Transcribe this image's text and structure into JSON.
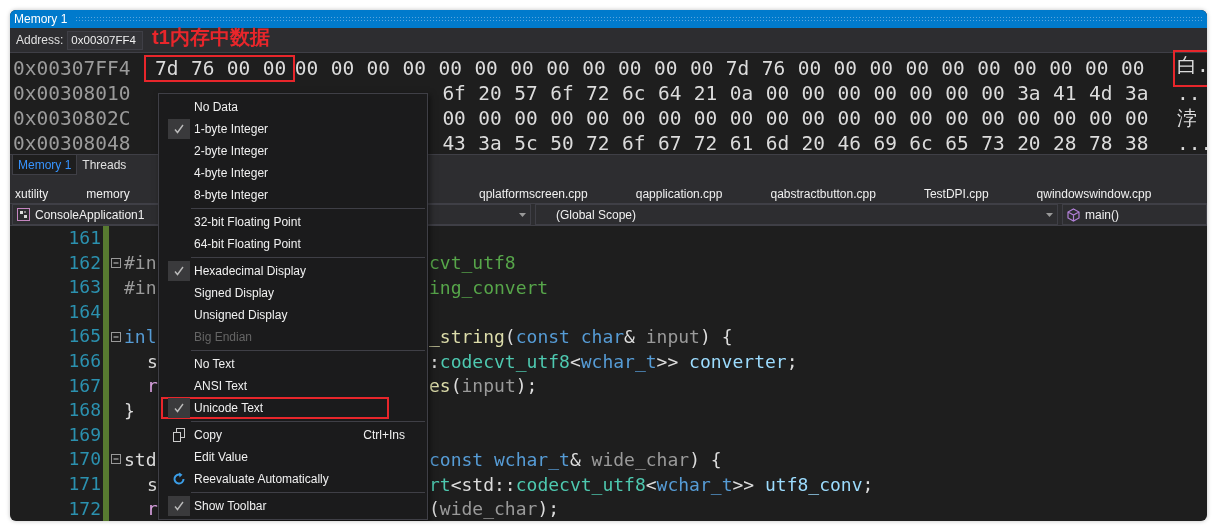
{
  "window": {
    "title": "Memory 1"
  },
  "annotation": {
    "label": "t1内存中数据"
  },
  "address_bar": {
    "label": "Address:",
    "value": "0x00307FF4"
  },
  "memory_rows": [
    {
      "address": "0x00307FF4",
      "marked_bytes": [
        "7d",
        "76",
        "00",
        "00"
      ],
      "bytes": [
        "00",
        "00",
        "00",
        "00",
        "00",
        "00",
        "00",
        "00",
        "00",
        "00",
        "00",
        "00",
        "7d",
        "76",
        "00",
        "00",
        "00",
        "00",
        "00",
        "00",
        "00",
        "00",
        "00",
        "00"
      ],
      "text": "白.",
      "text_marked": true
    },
    {
      "address": "0x00308010",
      "after_menu": [
        "6f",
        "20",
        "57",
        "6f",
        "72",
        "6c",
        "64",
        "21",
        "0a",
        "00",
        "00",
        "00",
        "00",
        "00",
        "00",
        "00",
        "3a",
        "41",
        "4d",
        "3a"
      ],
      "text": "..",
      "text_marked": false
    },
    {
      "address": "0x0030802C",
      "after_menu": [
        "00",
        "00",
        "00",
        "00",
        "00",
        "00",
        "00",
        "00",
        "00",
        "00",
        "00",
        "00",
        "00",
        "00",
        "00",
        "00",
        "00",
        "00",
        "00",
        "00"
      ],
      "text": "浡",
      "text_marked": false
    },
    {
      "address": "0x00308048",
      "after_menu": [
        "43",
        "3a",
        "5c",
        "50",
        "72",
        "6f",
        "67",
        "72",
        "61",
        "6d",
        "20",
        "46",
        "69",
        "6c",
        "65",
        "73",
        "20",
        "28",
        "78",
        "38"
      ],
      "text": "...",
      "text_marked": false
    }
  ],
  "panel_tabs": [
    {
      "label": "Memory 1",
      "selected": true
    },
    {
      "label": "Threads",
      "selected": false
    }
  ],
  "file_tabs_left": [
    "xutility",
    "memory"
  ],
  "file_tabs_right": [
    "qplatformscreen.cpp",
    "qapplication.cpp",
    "qabstractbutton.cpp",
    "TestDPI.cpp",
    "qwindowswindow.cpp"
  ],
  "nav_bar": {
    "project": "ConsoleApplication1",
    "scope": "(Global Scope)",
    "member": "main()"
  },
  "code_lines": [
    {
      "number": "161",
      "fold": false
    },
    {
      "number": "162",
      "fold": true,
      "indent": false,
      "left": [
        {
          "t": "#in",
          "kind": "preproc"
        }
      ],
      "right": [
        {
          "t": "cvt_utf8",
          "kind": "green"
        }
      ]
    },
    {
      "number": "163",
      "fold": false,
      "indent": false,
      "left": [
        {
          "t": "#in",
          "kind": "preproc"
        }
      ],
      "right": [
        {
          "t": "ing_convert",
          "kind": "green"
        }
      ]
    },
    {
      "number": "164",
      "fold": false
    },
    {
      "number": "165",
      "fold": true,
      "indent": false,
      "left": [
        {
          "t": "inl",
          "kind": "keyword"
        }
      ],
      "right": [
        {
          "t": "_string",
          "kind": "func"
        },
        {
          "t": "(",
          "kind": "plain"
        },
        {
          "t": "const",
          "kind": "keyword"
        },
        {
          "t": " char",
          "kind": "keyword"
        },
        {
          "t": "& ",
          "kind": "plain"
        },
        {
          "t": "input",
          "kind": "param"
        },
        {
          "t": ") {",
          "kind": "plain"
        }
      ]
    },
    {
      "number": "166",
      "fold": false,
      "indent": true,
      "left": [
        {
          "t": "s",
          "kind": "plain"
        }
      ],
      "right": [
        {
          "t": ":",
          "kind": "plain"
        },
        {
          "t": "codecvt_utf8",
          "kind": "type"
        },
        {
          "t": "<",
          "kind": "plain"
        },
        {
          "t": "wchar_t",
          "kind": "keyword"
        },
        {
          "t": ">> ",
          "kind": "plain"
        },
        {
          "t": "converter",
          "kind": "var"
        },
        {
          "t": ";",
          "kind": "plain"
        }
      ]
    },
    {
      "number": "167",
      "fold": false,
      "indent": true,
      "left": [
        {
          "t": "r",
          "kind": "control"
        }
      ],
      "right": [
        {
          "t": "es",
          "kind": "func"
        },
        {
          "t": "(",
          "kind": "plain"
        },
        {
          "t": "input",
          "kind": "param"
        },
        {
          "t": ");",
          "kind": "plain"
        }
      ]
    },
    {
      "number": "168",
      "fold": false,
      "indent": false,
      "left": [
        {
          "t": "}",
          "kind": "plain"
        }
      ]
    },
    {
      "number": "169",
      "fold": false
    },
    {
      "number": "170",
      "fold": true,
      "indent": false,
      "left": [
        {
          "t": "std",
          "kind": "plain"
        }
      ],
      "right": [
        {
          "t": "const",
          "kind": "keyword"
        },
        {
          "t": " wchar_t",
          "kind": "keyword"
        },
        {
          "t": "& ",
          "kind": "plain"
        },
        {
          "t": "wide_char",
          "kind": "param"
        },
        {
          "t": ") {",
          "kind": "plain"
        }
      ]
    },
    {
      "number": "171",
      "fold": false,
      "indent": true,
      "left": [
        {
          "t": "s",
          "kind": "plain"
        }
      ],
      "right": [
        {
          "t": "rt",
          "kind": "type"
        },
        {
          "t": "<std::",
          "kind": "plain"
        },
        {
          "t": "codecvt_utf8",
          "kind": "type"
        },
        {
          "t": "<",
          "kind": "plain"
        },
        {
          "t": "wchar_t",
          "kind": "keyword"
        },
        {
          "t": ">> ",
          "kind": "plain"
        },
        {
          "t": "utf8_conv",
          "kind": "var"
        },
        {
          "t": ";",
          "kind": "plain"
        }
      ]
    },
    {
      "number": "172",
      "fold": false,
      "indent": true,
      "left": [
        {
          "t": "r",
          "kind": "control"
        }
      ],
      "right": [
        {
          "t": "(",
          "kind": "plain"
        },
        {
          "t": "wide_char",
          "kind": "param"
        },
        {
          "t": ");",
          "kind": "plain"
        }
      ]
    }
  ],
  "context_menu": {
    "items": [
      {
        "kind": "item",
        "label": "No Data",
        "checked": false,
        "disabled": false,
        "marked": false
      },
      {
        "kind": "item",
        "label": "1-byte Integer",
        "checked": true,
        "disabled": false,
        "marked": false
      },
      {
        "kind": "item",
        "label": "2-byte Integer",
        "checked": false,
        "disabled": false,
        "marked": false
      },
      {
        "kind": "item",
        "label": "4-byte Integer",
        "checked": false,
        "disabled": false,
        "marked": false
      },
      {
        "kind": "item",
        "label": "8-byte Integer",
        "checked": false,
        "disabled": false,
        "marked": false
      },
      {
        "kind": "separator"
      },
      {
        "kind": "item",
        "label": "32-bit Floating Point",
        "checked": false,
        "disabled": false,
        "marked": false
      },
      {
        "kind": "item",
        "label": "64-bit Floating Point",
        "checked": false,
        "disabled": false,
        "marked": false
      },
      {
        "kind": "separator"
      },
      {
        "kind": "item",
        "label": "Hexadecimal Display",
        "checked": true,
        "disabled": false,
        "marked": false
      },
      {
        "kind": "item",
        "label": "Signed Display",
        "checked": false,
        "disabled": false,
        "marked": false
      },
      {
        "kind": "item",
        "label": "Unsigned Display",
        "checked": false,
        "disabled": false,
        "marked": false
      },
      {
        "kind": "item",
        "label": "Big Endian",
        "checked": false,
        "disabled": true,
        "marked": false
      },
      {
        "kind": "separator"
      },
      {
        "kind": "item",
        "label": "No Text",
        "checked": false,
        "disabled": false,
        "marked": false
      },
      {
        "kind": "item",
        "label": "ANSI Text",
        "checked": false,
        "disabled": false,
        "marked": false
      },
      {
        "kind": "item",
        "label": "Unicode Text",
        "checked": true,
        "disabled": false,
        "marked": true
      },
      {
        "kind": "separator"
      },
      {
        "kind": "copy",
        "label": "Copy",
        "shortcut": "Ctrl+Ins",
        "checked": false,
        "disabled": false,
        "marked": false
      },
      {
        "kind": "item",
        "label": "Edit Value",
        "checked": false,
        "disabled": false,
        "marked": false
      },
      {
        "kind": "reevaluate",
        "label": "Reevaluate Automatically",
        "checked": false,
        "disabled": false,
        "marked": false
      },
      {
        "kind": "separator"
      },
      {
        "kind": "item",
        "label": "Show Toolbar",
        "checked": true,
        "disabled": false,
        "marked": false
      }
    ]
  }
}
